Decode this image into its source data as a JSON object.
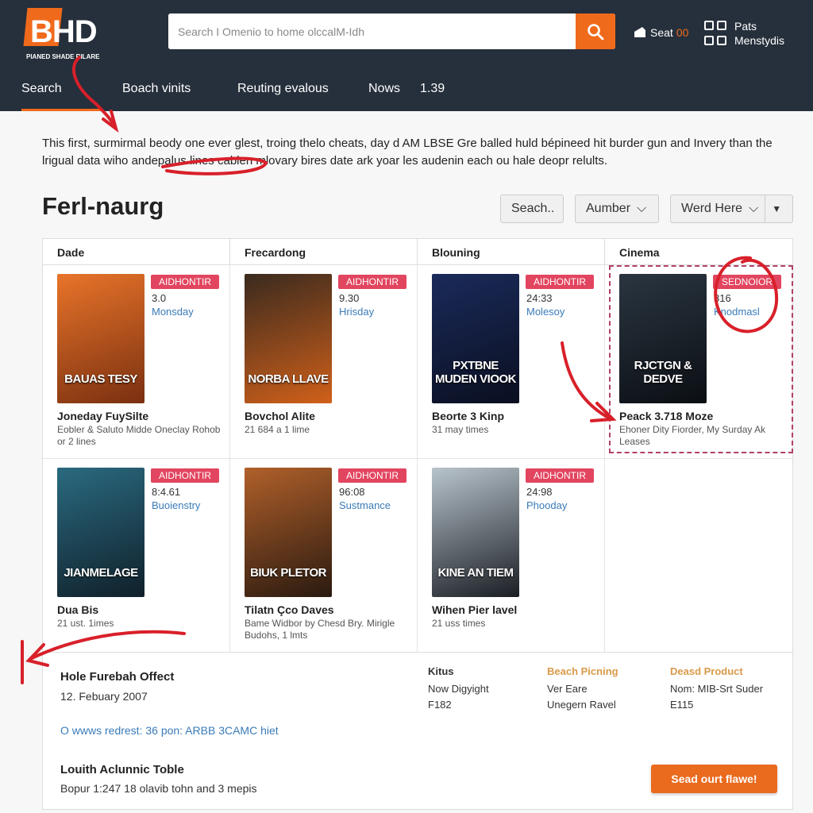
{
  "header": {
    "logo_text": "BHD",
    "logo_tagline": "PIANED SHADE RILARE",
    "search_placeholder": "Search I Omenio to home olccalM-Idh",
    "seat_label": "Seat",
    "seat_count": "00",
    "account_line1": "Pats",
    "account_line2": "Menstydis"
  },
  "nav": [
    {
      "label": "Search",
      "active": true
    },
    {
      "label": "Boach vinits"
    },
    {
      "label": "Reuting evalous"
    },
    {
      "label": "Nows"
    },
    {
      "label": "1.39"
    }
  ],
  "intro": "This first, surmirmal beody one ever glest, troing thelo cheats, day d AM LBSE Gre balled huld bépineed hit burder gun and Invery than the lrigual data wiho andepalus lines cablen mlovary bires date ark yoar les audenin each ou hale deopr relults.",
  "page_title": "Ferl-naurg",
  "filters": {
    "search": "Seach..",
    "sort": "Aumber",
    "view": "Werd Here"
  },
  "columns": [
    "Dade",
    "Frecardong",
    "Blouning",
    "Cinema"
  ],
  "movies": [
    {
      "poster_text": "BAUAS TESY",
      "badge": "AIDHONTIR",
      "rating": "3.0",
      "day": "Monsday",
      "title": "Joneday FuySilte",
      "subtitle": "Eobler & Saluto Midde Oneclay Rohob or 2 lines",
      "colors": [
        "#e8742a",
        "#7a3010"
      ]
    },
    {
      "poster_text": "NORBA LLAVE",
      "badge": "AIDHONTIR",
      "rating": "9.30",
      "day": "Hrisday",
      "title": "Bovchol Alite",
      "subtitle": "21 684 a 1 lime",
      "colors": [
        "#3a2a1e",
        "#d0601a"
      ]
    },
    {
      "poster_text": "PXTBNE MUDEN VIOOK",
      "badge": "AIDHONTIR",
      "rating": "24:33",
      "day": "Molesoy",
      "title": "Beorte 3 Kinp",
      "subtitle": "31 may times",
      "colors": [
        "#1a2a5a",
        "#0a0f20"
      ]
    },
    {
      "poster_text": "RJCTGN & DEDVE",
      "badge": "SEDNOIOR",
      "rating": "816",
      "day": "Knodmasl",
      "title": "Peack 3.718 Moze",
      "subtitle": "Ehoner Dity Fiorder, My Surday Ak Leases",
      "colors": [
        "#2a3540",
        "#0b0f14"
      ]
    },
    {
      "poster_text": "JIANMELAGE",
      "badge": "AIDHONTIR",
      "rating": "8:4.61",
      "day": "Buoienstry",
      "title": "Dua Bis",
      "subtitle": "21 ust. 1imes",
      "colors": [
        "#2a6a80",
        "#10202a"
      ]
    },
    {
      "poster_text": "BIUK PLETOR",
      "badge": "AIDHONTIR",
      "rating": "96:08",
      "day": "Sustmance",
      "title": "Tilatn Çco Daves",
      "subtitle": "Bame Widbor by Chesd Bry. Mirigle Budohs, 1 lmts",
      "colors": [
        "#b0602a",
        "#2a1a10"
      ]
    },
    {
      "poster_text": "KINE AN TIEM",
      "badge": "AIDHONTIR",
      "rating": "24:98",
      "day": "Phooday",
      "title": "Wihen Pier lavel",
      "subtitle": "21 uss times",
      "colors": [
        "#b8c4cc",
        "#1a1e24"
      ]
    }
  ],
  "bottom": {
    "event_title": "Hole Furebah Offect",
    "event_date": "12. Febuary 2007",
    "info_columns": [
      {
        "heading": "Kitus",
        "lines": [
          "Now Digyight",
          "F182"
        ],
        "color": "#333333"
      },
      {
        "heading": "Beach Picning",
        "lines": [
          "Ver Eare",
          "Unegern Ravel"
        ],
        "color": "#d99a4a"
      },
      {
        "heading": "Deasd Product",
        "lines": [
          "Nom: MIB-Srt Suder",
          "E115"
        ],
        "color": "#d99a4a"
      }
    ],
    "link": "O wwws redrest: 36 pon: ARBB 3CAMC hiet",
    "table_title": "Louith Aclunnic Toble",
    "table_sub": "Bopur 1:247 18 olavib tohn and 3 mepis",
    "cta": "Sead ourt flawe!"
  },
  "colors": {
    "header_bg": "#26303c",
    "accent": "#f06a1c",
    "badge": "#e2455f",
    "link": "#3a7bb8",
    "annotation": "#d8202a"
  }
}
